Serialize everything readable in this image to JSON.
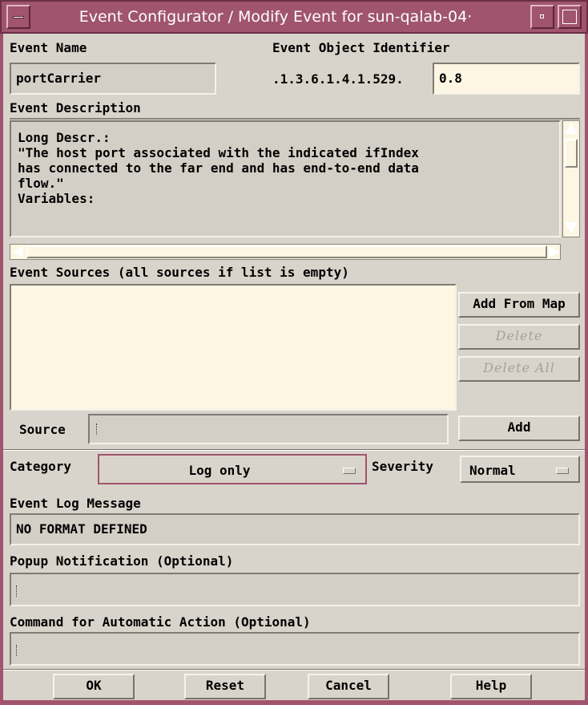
{
  "window": {
    "title": "Event Configurator / Modify Event for sun-qalab-04·"
  },
  "event_name": {
    "label": "Event Name",
    "value": "portCarrier"
  },
  "event_oid": {
    "label": "Event Object Identifier",
    "prefix": ".1.3.6.1.4.1.529.",
    "value": "0.8"
  },
  "event_description": {
    "label": "Event Description",
    "text": "Long Descr.:\n\"The host port associated with the indicated ifIndex\nhas connected to the far end and has end-to-end data\nflow.\"\nVariables:"
  },
  "event_sources": {
    "label": "Event Sources (all sources if list is empty)",
    "items": [],
    "add_from_map_label": "Add From Map",
    "delete_label": "Delete",
    "delete_all_label": "Delete All",
    "source_label": "Source",
    "source_value": "",
    "add_label": "Add"
  },
  "category": {
    "label": "Category",
    "value": "Log only"
  },
  "severity": {
    "label": "Severity",
    "value": "Normal"
  },
  "event_log_message": {
    "label": "Event Log Message",
    "value": "NO FORMAT DEFINED"
  },
  "popup_notification": {
    "label": "Popup Notification (Optional)",
    "value": ""
  },
  "command_action": {
    "label": "Command for Automatic Action (Optional)",
    "value": ""
  },
  "footer": {
    "ok_label": "OK",
    "reset_label": "Reset",
    "cancel_label": "Cancel",
    "help_label": "Help"
  },
  "colors": {
    "titlebar": "#a0546e",
    "background": "#d9d4cb",
    "field": "#d4cfc6",
    "field_light": "#fdf6e2"
  }
}
